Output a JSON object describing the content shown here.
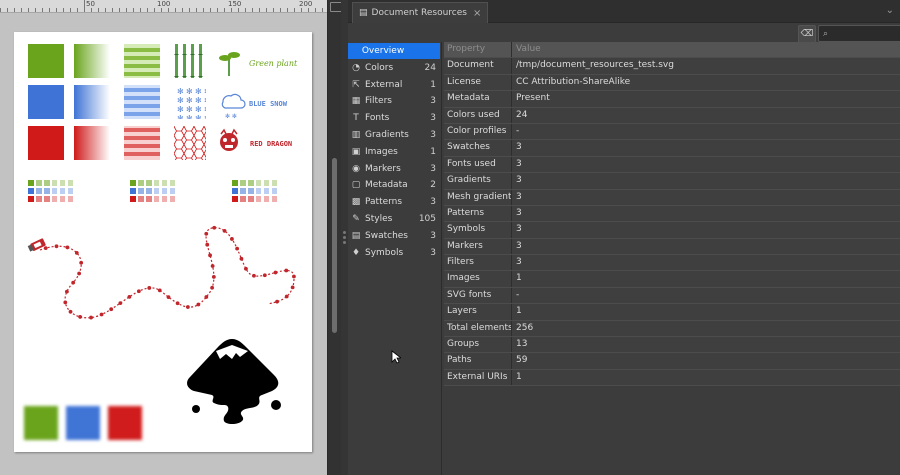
{
  "ruler": {
    "labels": [
      "50",
      "100",
      "150",
      "200"
    ]
  },
  "canvas": {
    "texts": {
      "green": "Green plant",
      "blue": "BLUE SNOW",
      "red": "RED DRAGON"
    },
    "colors": {
      "green": "#6aa41d",
      "blue": "#3f74d6",
      "red": "#d01a1a",
      "path": "#c0272d"
    }
  },
  "panel": {
    "tab_label": "Document Resources",
    "tab_close": "×",
    "collapse_icon": "⌄",
    "search": {
      "placeholder": ""
    }
  },
  "sidebar": {
    "items": [
      {
        "label": "Overview",
        "count": "",
        "icon": "overview",
        "active": true
      },
      {
        "label": "Colors",
        "count": "24",
        "icon": "palette-icon"
      },
      {
        "label": "External",
        "count": "1",
        "icon": "external-icon"
      },
      {
        "label": "Filters",
        "count": "3",
        "icon": "filter-icon"
      },
      {
        "label": "Fonts",
        "count": "3",
        "icon": "font-icon"
      },
      {
        "label": "Gradients",
        "count": "3",
        "icon": "gradient-icon"
      },
      {
        "label": "Images",
        "count": "1",
        "icon": "image-icon"
      },
      {
        "label": "Markers",
        "count": "3",
        "icon": "marker-icon"
      },
      {
        "label": "Metadata",
        "count": "2",
        "icon": "metadata-icon"
      },
      {
        "label": "Patterns",
        "count": "3",
        "icon": "pattern-icon"
      },
      {
        "label": "Styles",
        "count": "105",
        "icon": "style-icon"
      },
      {
        "label": "Swatches",
        "count": "3",
        "icon": "swatch-icon"
      },
      {
        "label": "Symbols",
        "count": "3",
        "icon": "symbol-icon"
      }
    ]
  },
  "table": {
    "headers": {
      "property": "Property",
      "value": "Value"
    },
    "rows": [
      {
        "property": "Document",
        "value": "/tmp/document_resources_test.svg"
      },
      {
        "property": "License",
        "value": "CC Attribution-ShareAlike"
      },
      {
        "property": "Metadata",
        "value": "Present"
      },
      {
        "property": "Colors used",
        "value": "24"
      },
      {
        "property": "Color profiles",
        "value": "-"
      },
      {
        "property": "Swatches",
        "value": "3"
      },
      {
        "property": "Fonts used",
        "value": "3"
      },
      {
        "property": "Gradients",
        "value": "3"
      },
      {
        "property": "Mesh gradients",
        "value": "3"
      },
      {
        "property": "Patterns",
        "value": "3"
      },
      {
        "property": "Symbols",
        "value": "3"
      },
      {
        "property": "Markers",
        "value": "3"
      },
      {
        "property": "Filters",
        "value": "3"
      },
      {
        "property": "Images",
        "value": "1"
      },
      {
        "property": "SVG fonts",
        "value": "-"
      },
      {
        "property": "Layers",
        "value": "1"
      },
      {
        "property": "Total elements",
        "value": "256"
      },
      {
        "property": "Groups",
        "value": "13"
      },
      {
        "property": "Paths",
        "value": "59"
      },
      {
        "property": "External URIs",
        "value": "1"
      }
    ]
  }
}
